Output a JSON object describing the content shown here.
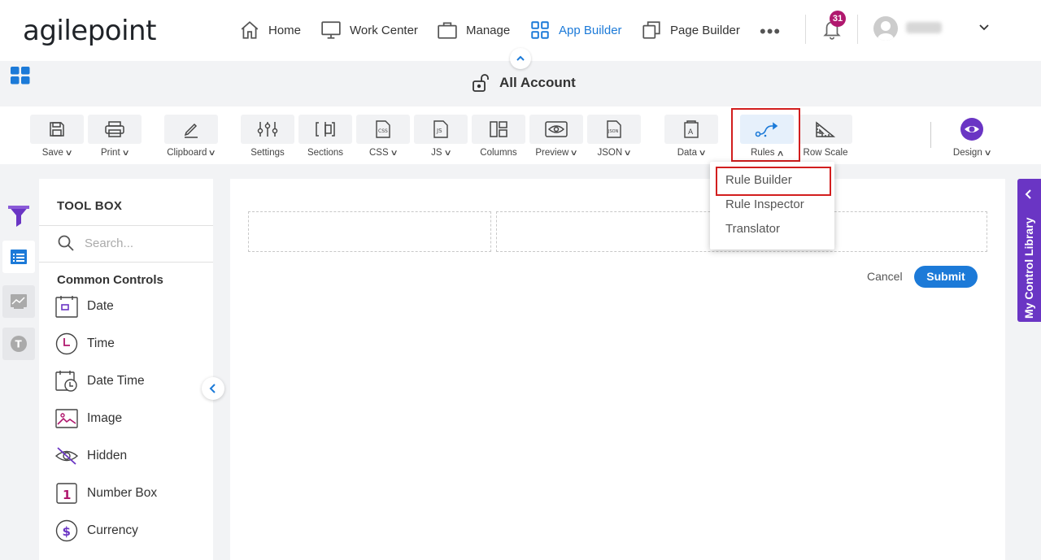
{
  "nav": {
    "logo": "agilepoint",
    "items": [
      {
        "label": "Home",
        "icon": "home-icon"
      },
      {
        "label": "Work Center",
        "icon": "monitor-icon"
      },
      {
        "label": "Manage",
        "icon": "briefcase-icon"
      },
      {
        "label": "App Builder",
        "icon": "app-grid-icon",
        "active": true
      },
      {
        "label": "Page Builder",
        "icon": "pages-icon"
      }
    ],
    "more": "•••",
    "notification_count": "31"
  },
  "page_title": "All Account",
  "toolbar": {
    "save": "Save",
    "print": "Print",
    "clipboard": "Clipboard",
    "settings": "Settings",
    "sections": "Sections",
    "css": "CSS",
    "js": "JS",
    "columns": "Columns",
    "preview": "Preview",
    "json": "JSON",
    "data": "Data",
    "rules": "Rules",
    "row_scale": "Row Scale",
    "design": "Design"
  },
  "rules_menu": {
    "items": [
      "Rule Builder",
      "Rule Inspector",
      "Translator"
    ]
  },
  "toolbox": {
    "title": "TOOL BOX",
    "search_placeholder": "Search...",
    "category": "Common Controls",
    "controls": [
      "Date",
      "Time",
      "Date Time",
      "Image",
      "Hidden",
      "Number Box",
      "Currency"
    ]
  },
  "form": {
    "cancel": "Cancel",
    "submit": "Submit"
  },
  "control_library": "My Control Library",
  "colors": {
    "accent": "#1c7ad8",
    "purple": "#6a35c4",
    "badge": "#b0186e",
    "highlight": "#d21e1e"
  }
}
